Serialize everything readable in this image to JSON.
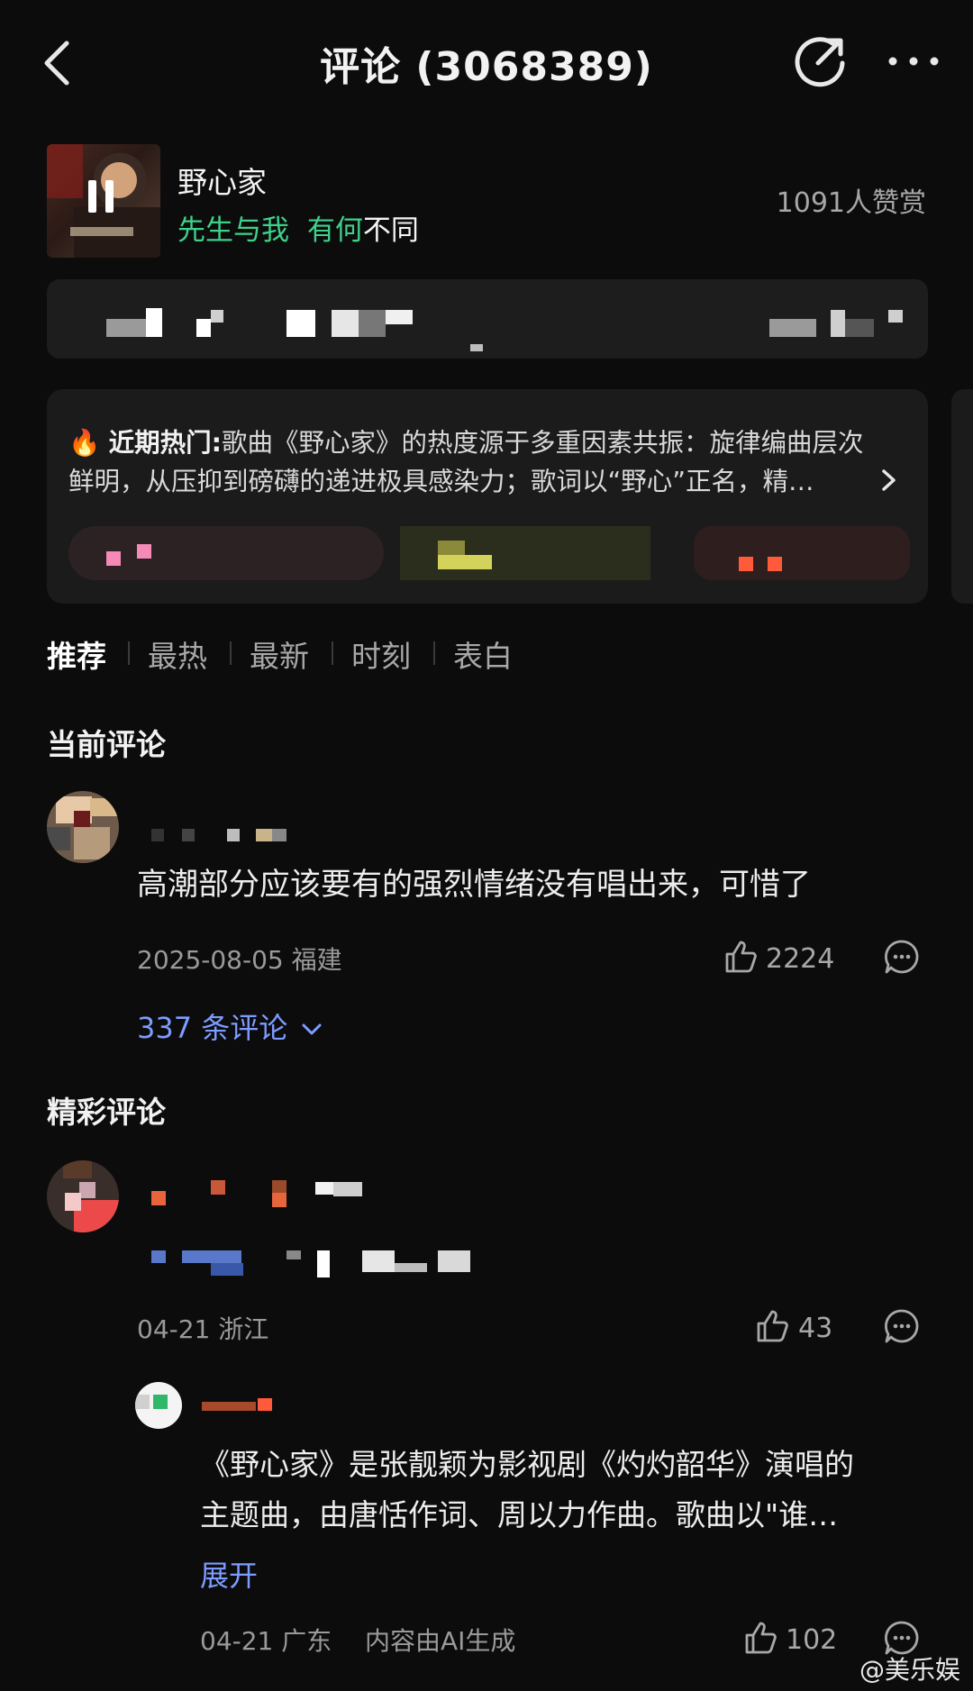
{
  "header": {
    "title": "评论 (3068389)"
  },
  "song": {
    "title": "野心家",
    "artist_part1": "先生与我",
    "artist_part2": "有何",
    "artist_part3": "不同",
    "reward_count": "1091人赞赏"
  },
  "hot_summary": {
    "label": "近期热门:",
    "text": "歌曲《野心家》的热度源于多重因素共振：旋律编曲层次鲜明，从压抑到磅礴的递进极具感染力；歌词以“野心”正名，精…"
  },
  "tabs": [
    {
      "label": "推荐",
      "active": true
    },
    {
      "label": "最热",
      "active": false
    },
    {
      "label": "最新",
      "active": false
    },
    {
      "label": "时刻",
      "active": false
    },
    {
      "label": "表白",
      "active": false
    }
  ],
  "current_comment": {
    "section_title": "当前评论",
    "text": "高潮部分应该要有的强烈情绪没有唱出来，可惜了",
    "date": "2025-08-05 福建",
    "likes": "2224",
    "replies_link": "337 条评论"
  },
  "featured": {
    "section_title": "精彩评论",
    "comment": {
      "date": "04-21 浙江",
      "likes": "43"
    },
    "reply": {
      "text_line1": "《野心家》是张靓颖为影视剧《灼灼韶华》演唱的",
      "text_line2": "主题曲，由唐恬作词、周以力作曲。歌曲以\"谁…",
      "expand_label": "展开",
      "date": "04-21 广东",
      "ai_note": "内容由AI生成",
      "likes": "102"
    }
  },
  "watermark": "@美乐娱",
  "colors": {
    "background": "#0c0c0c",
    "artist_green": "#3fd18a",
    "link_blue": "#7d9cff"
  }
}
